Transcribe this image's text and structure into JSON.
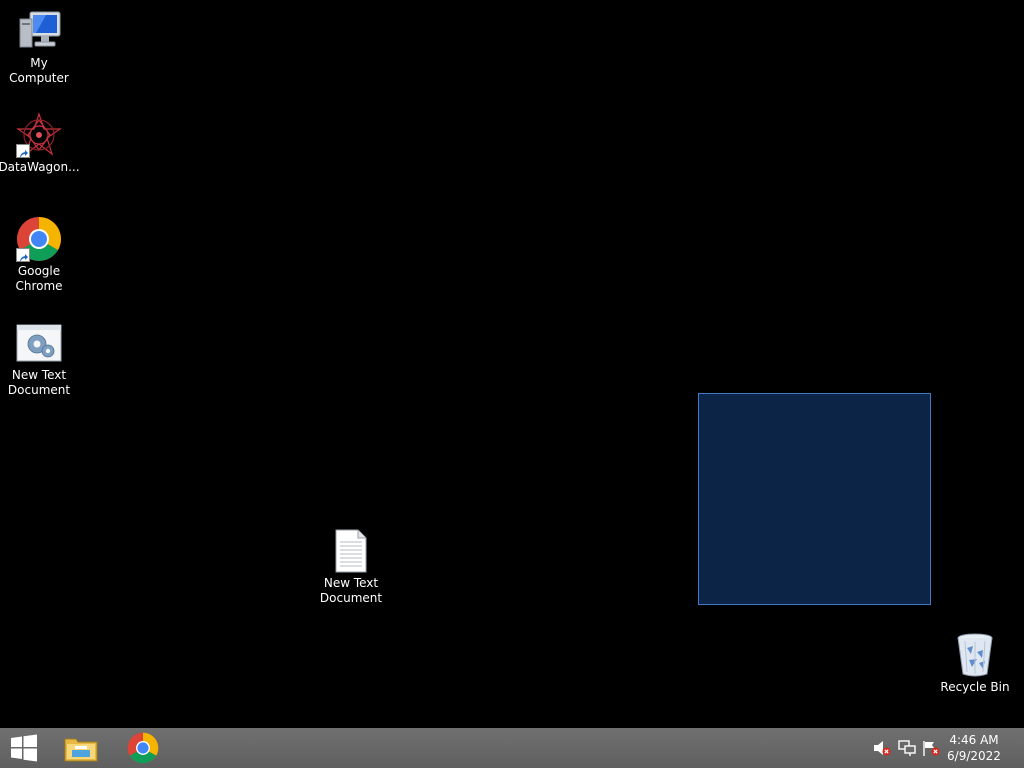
{
  "desktop": {
    "icons": [
      {
        "label": "My Computer",
        "icon": "computer-icon"
      },
      {
        "label": "DataWagon...",
        "icon": "datawagon-icon"
      },
      {
        "label": "Google\nChrome",
        "icon": "chrome-icon"
      },
      {
        "label": "New Text\nDocument",
        "icon": "settings-document-icon"
      },
      {
        "label": "New Text\nDocument",
        "icon": "text-document-icon"
      },
      {
        "label": "Recycle Bin",
        "icon": "recycle-bin-icon"
      }
    ]
  },
  "taskbar": {
    "pinned": [
      "start-icon",
      "file-explorer-icon",
      "chrome-icon"
    ],
    "tray": [
      "volume-muted-icon",
      "network-icon",
      "action-center-icon"
    ],
    "clock": {
      "time": "4:46 AM",
      "date": "6/9/2022"
    }
  },
  "colors": {
    "desktop_background": "#000000",
    "taskbar": "#6b6b6b",
    "selection_fill": "#0c2446",
    "selection_border": "#3f7cc7"
  }
}
